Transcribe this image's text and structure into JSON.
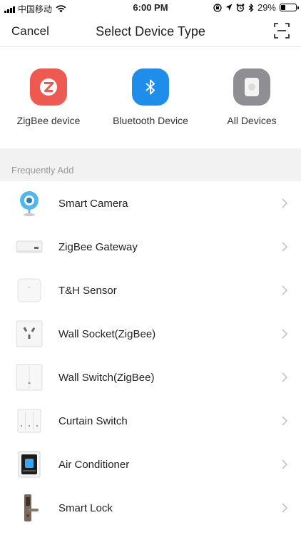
{
  "status_bar": {
    "carrier": "中国移动",
    "time": "6:00 PM",
    "battery_percent": "29%",
    "battery_level": 0.29
  },
  "nav": {
    "cancel_label": "Cancel",
    "title": "Select Device Type",
    "scan_icon": "scan-icon"
  },
  "device_types": [
    {
      "label": "ZigBee device",
      "icon": "zigbee-icon",
      "color": "#ee5a52"
    },
    {
      "label": "Bluetooth Device",
      "icon": "bluetooth-icon",
      "color": "#1f8eea"
    },
    {
      "label": "All Devices",
      "icon": "all-devices-icon",
      "color": "#8e8e93"
    }
  ],
  "section": {
    "frequently_add": "Frequently Add"
  },
  "devices": [
    {
      "label": "Smart Camera",
      "icon": "camera-icon"
    },
    {
      "label": "ZigBee Gateway",
      "icon": "gateway-icon"
    },
    {
      "label": "T&H Sensor",
      "icon": "sensor-icon"
    },
    {
      "label": "Wall Socket(ZigBee)",
      "icon": "socket-icon"
    },
    {
      "label": "Wall Switch(ZigBee)",
      "icon": "wall-switch-icon"
    },
    {
      "label": "Curtain Switch",
      "icon": "curtain-switch-icon"
    },
    {
      "label": "Air Conditioner",
      "icon": "air-conditioner-icon"
    },
    {
      "label": "Smart Lock",
      "icon": "lock-icon"
    }
  ]
}
